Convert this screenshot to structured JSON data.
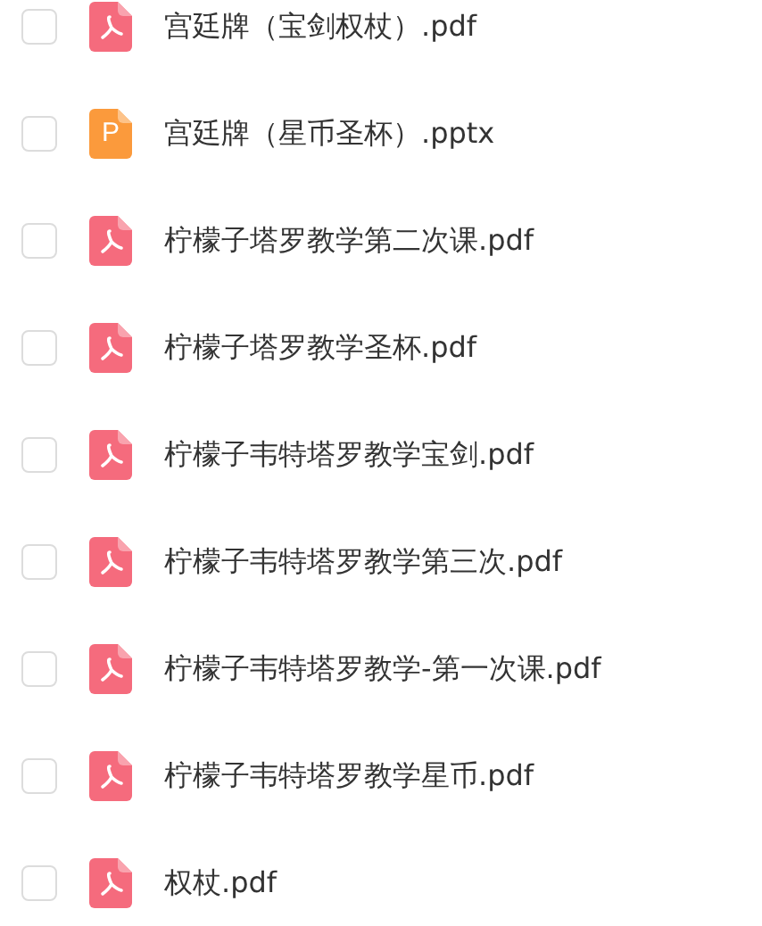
{
  "files": [
    {
      "name": "宫廷牌（宝剑权杖）.pdf",
      "kind": "pdf",
      "checked": false
    },
    {
      "name": "宫廷牌（星币圣杯）.pptx",
      "kind": "pptx",
      "icon_label": "P",
      "checked": false
    },
    {
      "name": "柠檬子塔罗教学第二次课.pdf",
      "kind": "pdf",
      "checked": false
    },
    {
      "name": "柠檬子塔罗教学圣杯.pdf",
      "kind": "pdf",
      "checked": false
    },
    {
      "name": "柠檬子韦特塔罗教学宝剑.pdf",
      "kind": "pdf",
      "checked": false
    },
    {
      "name": "柠檬子韦特塔罗教学第三次.pdf",
      "kind": "pdf",
      "checked": false
    },
    {
      "name": "柠檬子韦特塔罗教学-第一次课.pdf",
      "kind": "pdf",
      "checked": false
    },
    {
      "name": "柠檬子韦特塔罗教学星币.pdf",
      "kind": "pdf",
      "checked": false
    },
    {
      "name": "权杖.pdf",
      "kind": "pdf",
      "checked": false
    }
  ]
}
